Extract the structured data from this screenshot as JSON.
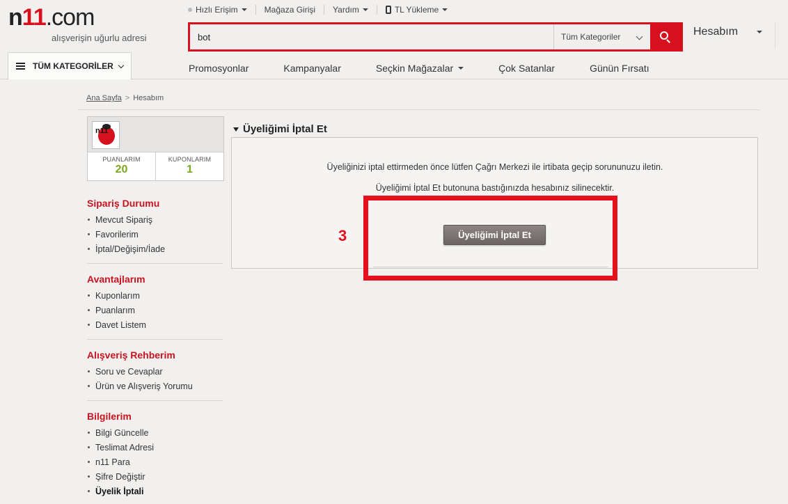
{
  "header": {
    "logo": {
      "part1": "n",
      "part2": "11",
      "part3": ".com",
      "slogan": "alışverişin uğurlu adresi"
    },
    "topnav": {
      "quick_access": "Hızlı Erişim",
      "store_login": "Mağaza Girişi",
      "help": "Yardım",
      "tl_load": "TL Yükleme"
    },
    "search": {
      "value": "bot",
      "category": "Tüm Kategoriler"
    },
    "account_label": "Hesabım",
    "all_categories": "TÜM KATEGORİLER",
    "mainnav": [
      "Promosyonlar",
      "Kampanyalar",
      "Seçkin Mağazalar",
      "Çok Satanlar",
      "Günün Fırsatı"
    ]
  },
  "breadcrumb": {
    "home": "Ana Sayfa",
    "separator": ">",
    "current": "Hesabım"
  },
  "profile": {
    "avatar_text": "n11",
    "points_label": "PUANLARIM",
    "points_value": "20",
    "coupons_label": "KUPONLARIM",
    "coupons_value": "1"
  },
  "sidebar": [
    {
      "title": "Sipariş Durumu",
      "items": [
        "Mevcut Sipariş",
        "Favorilerim",
        "İptal/Değişim/İade"
      ]
    },
    {
      "title": "Avantajlarım",
      "items": [
        "Kuponlarım",
        "Puanlarım",
        "Davet Listem"
      ]
    },
    {
      "title": "Alışveriş Rehberim",
      "items": [
        "Soru ve Cevaplar",
        "Ürün ve Alışveriş Yorumu"
      ]
    },
    {
      "title": "Bilgilerim",
      "items": [
        "Bilgi Güncelle",
        "Teslimat Adresi",
        "n11 Para",
        "Şifre Değiştir",
        "Üyelik İptali"
      ]
    }
  ],
  "content": {
    "title": "Üyeliğimi İptal Et",
    "message1": "Üyeliğinizi iptal ettirmeden önce lütfen Çağrı Merkezi ile irtibata geçip sorununuzu iletin.",
    "message2": "Üyeliğimi İptal Et butonuna bastığınızda hesabınız silinecektir.",
    "button_label": "Üyeliğimi İptal Et",
    "step_number": "3"
  },
  "colors": {
    "brand_red": "#d6101c",
    "highlight_red": "#e5101b",
    "points_green": "#7aa81b",
    "button_gray": "#7a7371"
  }
}
